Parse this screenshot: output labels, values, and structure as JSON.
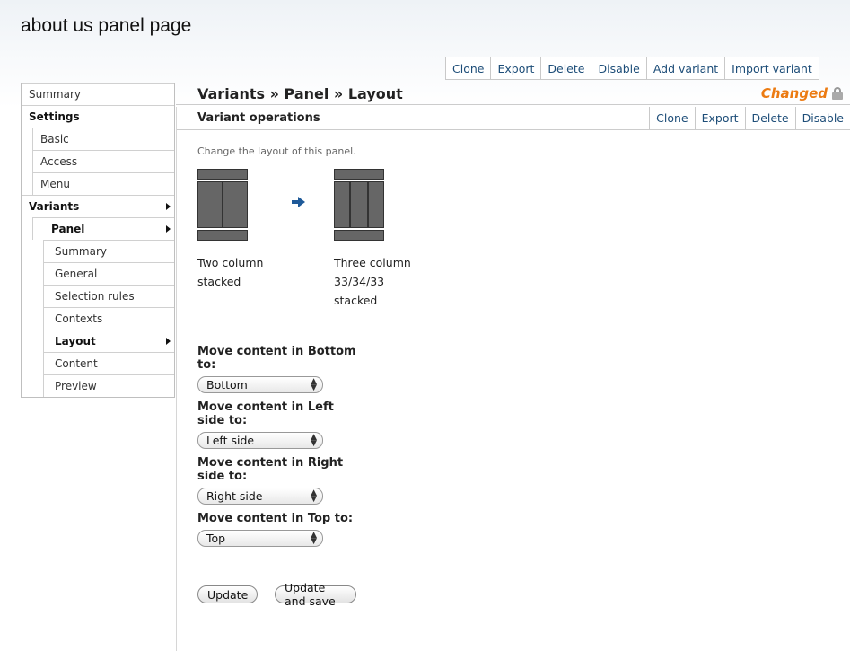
{
  "page": {
    "title": "about us panel page"
  },
  "top_ops": [
    "Clone",
    "Export",
    "Delete",
    "Disable",
    "Add variant",
    "Import variant"
  ],
  "sidebar": {
    "items": [
      {
        "label": "Summary"
      },
      {
        "label": "Settings"
      },
      {
        "label": "Basic"
      },
      {
        "label": "Access"
      },
      {
        "label": "Menu"
      },
      {
        "label": "Variants"
      },
      {
        "label": "Panel"
      },
      {
        "label": "Summary"
      },
      {
        "label": "General"
      },
      {
        "label": "Selection rules"
      },
      {
        "label": "Contexts"
      },
      {
        "label": "Layout"
      },
      {
        "label": "Content"
      },
      {
        "label": "Preview"
      }
    ]
  },
  "main": {
    "breadcrumb": "Variants » Panel » Layout",
    "status": "Changed",
    "sub_title": "Variant operations",
    "variant_ops": [
      "Clone",
      "Export",
      "Delete",
      "Disable"
    ],
    "description": "Change the layout of this panel.",
    "from_layout": {
      "line1": "Two column",
      "line2": "stacked"
    },
    "to_layout": {
      "line1": "Three column",
      "line2": "33/34/33",
      "line3": "stacked"
    },
    "moves": [
      {
        "label": "Move content in Bottom to:",
        "value": "Bottom"
      },
      {
        "label": "Move content in Left side to:",
        "value": "Left side"
      },
      {
        "label": "Move content in Right side to:",
        "value": "Right side"
      },
      {
        "label": "Move content in Top to:",
        "value": "Top"
      }
    ],
    "buttons": {
      "update": "Update",
      "update_save": "Update and save"
    }
  },
  "icons": {
    "arrow": "arrow-right-icon",
    "lock": "lock-icon",
    "select": "updown-icon"
  },
  "colors": {
    "link": "#1d4d78",
    "changed": "#ec7b12",
    "arrow": "#1f5a99"
  }
}
